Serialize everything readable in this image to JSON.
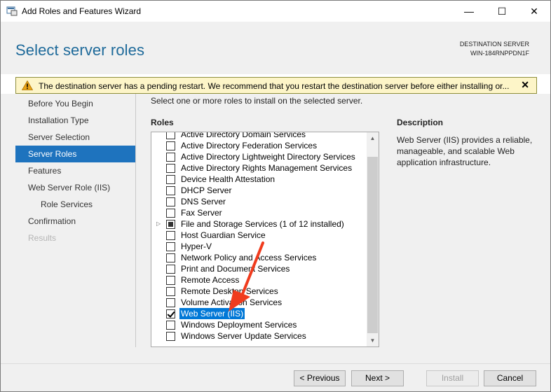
{
  "window": {
    "title": "Add Roles and Features Wizard",
    "minimize": "—",
    "maximize": "☐",
    "close": "✕"
  },
  "header": {
    "page_title": "Select server roles",
    "dest_label": "DESTINATION SERVER",
    "dest_value": "WIN-184RNPPDN1F"
  },
  "warning": {
    "text": "The destination server has a pending restart. We recommend that you restart the destination server before either installing or...",
    "close": "✕",
    "icon": "warning-icon"
  },
  "nav": {
    "items": [
      {
        "label": "Before You Begin",
        "state": "normal"
      },
      {
        "label": "Installation Type",
        "state": "normal"
      },
      {
        "label": "Server Selection",
        "state": "normal"
      },
      {
        "label": "Server Roles",
        "state": "active"
      },
      {
        "label": "Features",
        "state": "normal"
      },
      {
        "label": "Web Server Role (IIS)",
        "state": "normal"
      },
      {
        "label": "Role Services",
        "state": "sub"
      },
      {
        "label": "Confirmation",
        "state": "normal"
      },
      {
        "label": "Results",
        "state": "disabled"
      }
    ]
  },
  "main": {
    "instruction": "Select one or more roles to install on the selected server.",
    "roles_label": "Roles",
    "roles": [
      {
        "label": "Active Directory Domain Services",
        "state": "unchecked"
      },
      {
        "label": "Active Directory Federation Services",
        "state": "unchecked"
      },
      {
        "label": "Active Directory Lightweight Directory Services",
        "state": "unchecked"
      },
      {
        "label": "Active Directory Rights Management Services",
        "state": "unchecked"
      },
      {
        "label": "Device Health Attestation",
        "state": "unchecked"
      },
      {
        "label": "DHCP Server",
        "state": "unchecked"
      },
      {
        "label": "DNS Server",
        "state": "unchecked"
      },
      {
        "label": "Fax Server",
        "state": "unchecked"
      },
      {
        "label": "File and Storage Services (1 of 12 installed)",
        "state": "partial",
        "expandable": true
      },
      {
        "label": "Host Guardian Service",
        "state": "unchecked"
      },
      {
        "label": "Hyper-V",
        "state": "unchecked"
      },
      {
        "label": "Network Policy and Access Services",
        "state": "unchecked"
      },
      {
        "label": "Print and Document Services",
        "state": "unchecked"
      },
      {
        "label": "Remote Access",
        "state": "unchecked"
      },
      {
        "label": "Remote Desktop Services",
        "state": "unchecked"
      },
      {
        "label": "Volume Activation Services",
        "state": "unchecked"
      },
      {
        "label": "Web Server (IIS)",
        "state": "checked",
        "selected": true
      },
      {
        "label": "Windows Deployment Services",
        "state": "unchecked"
      },
      {
        "label": "Windows Server Update Services",
        "state": "unchecked"
      }
    ],
    "description_title": "Description",
    "description_text": "Web Server (IIS) provides a reliable, manageable, and scalable Web application infrastructure."
  },
  "footer": {
    "previous_label": "< Previous",
    "next_label": "Next >",
    "install_label": "Install",
    "cancel_label": "Cancel"
  },
  "colors": {
    "accent": "#1e73be",
    "title_blue": "#1e6a9a",
    "warning_bg": "#fdf5c8",
    "annotation_arrow": "#f03c1e"
  }
}
